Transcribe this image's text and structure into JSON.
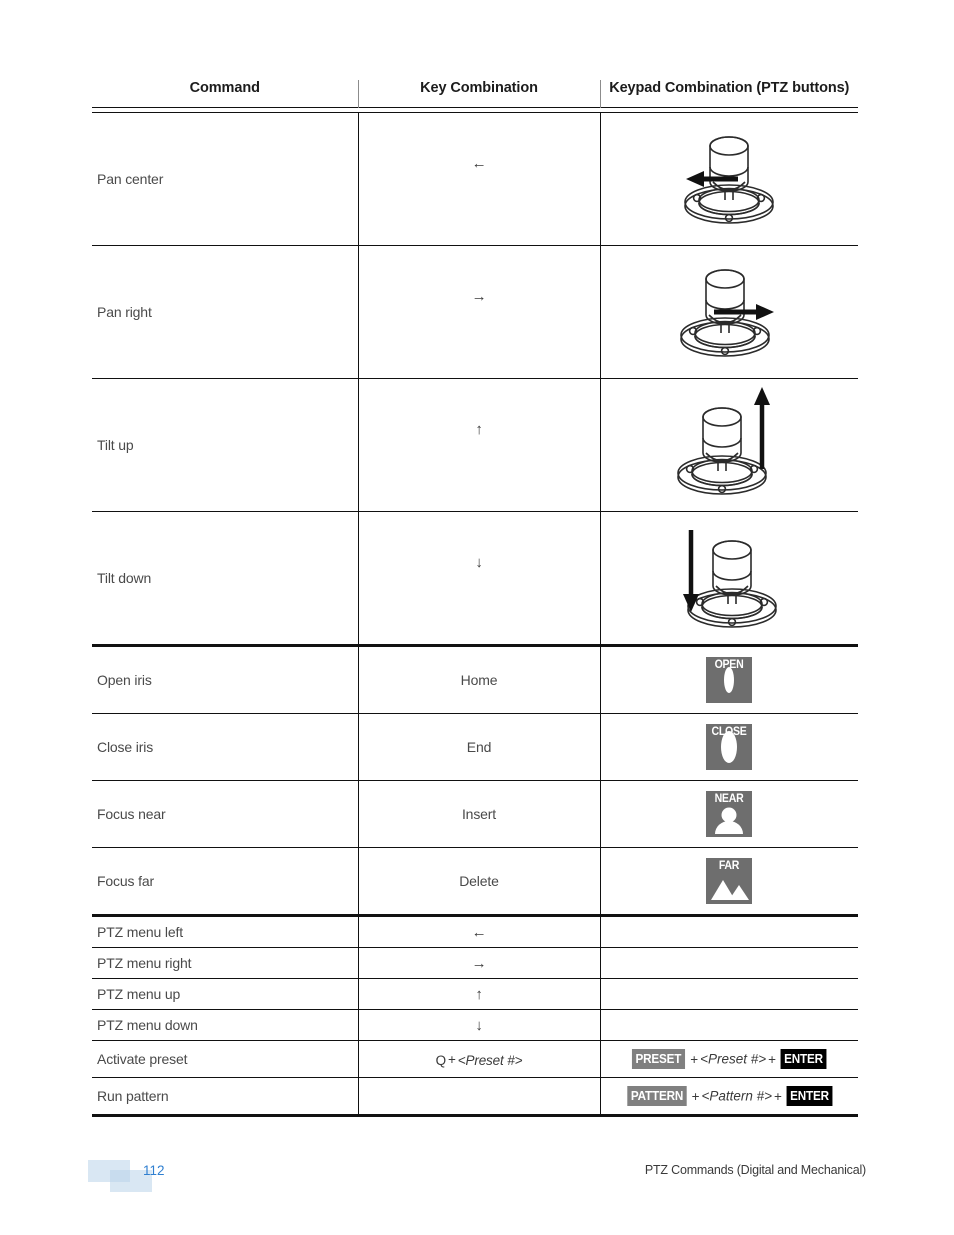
{
  "table": {
    "headers": [
      "Command",
      "Key Combination",
      "Keypad Combination (PTZ buttons)"
    ],
    "rows": [
      {
        "command": "Pan center",
        "key": "←",
        "key_icon": "left-arrow-icon",
        "keypad_icon": "joystick-pan-left-illustration"
      },
      {
        "command": "Pan right",
        "key": "→",
        "key_icon": "right-arrow-icon",
        "keypad_icon": "joystick-pan-right-illustration"
      },
      {
        "command": "Tilt up",
        "key": "↑",
        "key_icon": "up-arrow-icon",
        "keypad_icon": "joystick-tilt-up-illustration"
      },
      {
        "command": "Tilt down",
        "key": "↓",
        "key_icon": "down-arrow-icon",
        "keypad_icon": "joystick-tilt-down-illustration"
      },
      {
        "command": "Open iris",
        "key": "Home",
        "keypad_button": "OPEN",
        "keypad_icon": "open-iris-ring-icon"
      },
      {
        "command": "Close iris",
        "key": "End",
        "keypad_button": "CLOSE",
        "keypad_icon": "close-iris-donut-icon"
      },
      {
        "command": "Focus near",
        "key": "Insert",
        "keypad_button": "NEAR",
        "keypad_icon": "person-silhouette-icon"
      },
      {
        "command": "Focus far",
        "key": "Delete",
        "keypad_button": "FAR",
        "keypad_icon": "mountains-icon"
      },
      {
        "command": "PTZ menu left",
        "key": "←",
        "key_icon": "left-arrow-icon",
        "keypad_button": ""
      },
      {
        "command": "PTZ menu right",
        "key": "→",
        "key_icon": "right-arrow-icon",
        "keypad_button": ""
      },
      {
        "command": "PTZ menu up",
        "key": "↑",
        "key_icon": "up-arrow-icon",
        "keypad_button": ""
      },
      {
        "command": "PTZ menu down",
        "key": "↓",
        "key_icon": "down-arrow-icon",
        "keypad_button": ""
      },
      {
        "command": "Activate preset",
        "key": "Q + <Preset #>",
        "key_plain": "Q",
        "key_plus": "+",
        "key_italic": "<Preset #>",
        "keypad_badge_1": "PRESET",
        "keypad_italic": "<Preset #>",
        "keypad_badge_2": "ENTER"
      },
      {
        "command": "Run pattern",
        "key": "",
        "keypad_badge_1": "PATTERN",
        "keypad_italic": "<Pattern #>",
        "keypad_badge_2": "ENTER"
      }
    ],
    "plus_symbol": "+"
  },
  "footer": {
    "page_number": "112",
    "chapter": "PTZ Commands (Digital and Mechanical)"
  },
  "colors": {
    "page_number": "#2f7fd0",
    "logo": "#b9d3ea",
    "badge_gray": "#808080",
    "badge_black": "#000000",
    "button_gray": "#6e6e6e",
    "rule": "#111111",
    "body_text": "#4a4a4a"
  }
}
